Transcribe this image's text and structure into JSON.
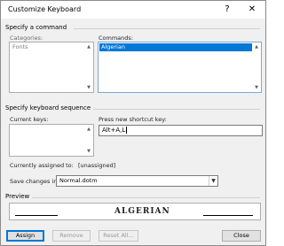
{
  "window": {
    "title": "Customize Keyboard",
    "help_glyph": "?",
    "close_glyph": "✕"
  },
  "command_section": {
    "heading": "Specify a command",
    "categories_label": "Categories:",
    "categories": [
      "Fonts"
    ],
    "commands_label": "Commands:",
    "commands": [
      "Algerian"
    ]
  },
  "shortcut_section": {
    "heading": "Specify keyboard sequence",
    "current_keys_label": "Current keys:",
    "new_key_label": "Press new shortcut key:",
    "new_key_value": "Alt+A,L",
    "assigned_label": "Currently assigned to:",
    "assigned_value": "[unassigned]",
    "save_in_label": "Save changes in:",
    "save_in_value": "Normal.dotm"
  },
  "preview": {
    "heading": "Preview",
    "sample_text": "ALGERIAN"
  },
  "buttons": {
    "assign": "Assign",
    "remove": "Remove",
    "reset_all": "Reset All...",
    "close": "Close"
  },
  "colors": {
    "selection": "#0078d7",
    "dialog_bg": "#f0f0f0"
  }
}
